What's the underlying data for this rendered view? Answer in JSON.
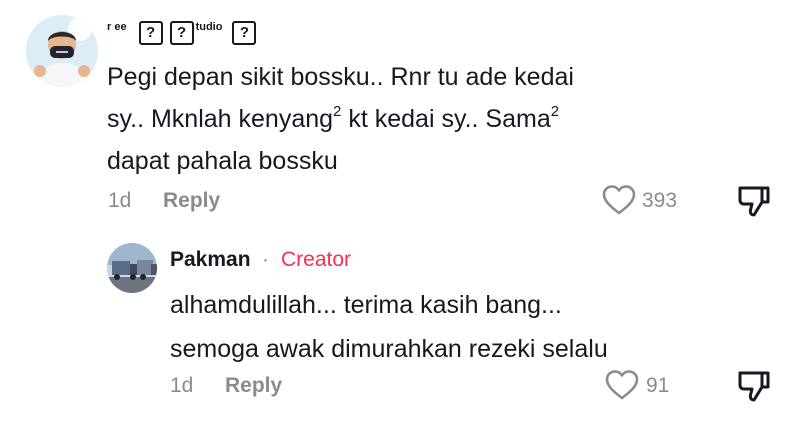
{
  "main_comment": {
    "username_prefix": "r ee",
    "username_glyph": "?",
    "username_mid": "tudio",
    "text_part1": "Pegi depan sikit bossku.. Rnr tu ade kedai",
    "text_part2": "sy.. Mknlah kenyang",
    "sup1": "2",
    "text_part3": " kt kedai sy.. Sama",
    "sup2": "2",
    "text_part4": "dapat pahala bossku",
    "time": "1d",
    "reply_label": "Reply",
    "like_count": "393",
    "avatar_icon": "user-avatar-masked-man"
  },
  "reply_comment": {
    "username": "Pakman",
    "separator": "·",
    "badge": "Creator",
    "badge_color": "#fe2c55",
    "text_line1": "alhamdulillah... terima kasih bang...",
    "text_line2": "semoga awak dimurahkan rezeki selalu",
    "time": "1d",
    "reply_label": "Reply",
    "like_count": "91",
    "avatar_icon": "user-avatar-trucks"
  },
  "icons": {
    "like": "heart-icon",
    "dislike": "thumbs-down-icon"
  }
}
